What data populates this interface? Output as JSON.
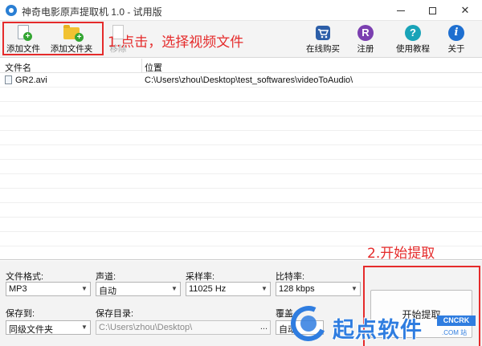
{
  "window": {
    "title": "神奇电影原声提取机 1.0 - 试用版",
    "min_icon": "minimize-icon",
    "max_icon": "maximize-icon",
    "close_glyph": "✕"
  },
  "toolbar": {
    "add_file": "添加文件",
    "add_folder": "添加文件夹",
    "remove": "移除",
    "buy": "在线购买",
    "register": "注册",
    "register_glyph": "R",
    "help": "使用教程",
    "help_glyph": "?",
    "about": "关于",
    "about_glyph": "i",
    "plus_glyph": "+"
  },
  "annotations": {
    "step1": "1.点击，选择视频文件",
    "step2": "2.开始提取"
  },
  "file_list": {
    "col_name": "文件名",
    "col_location": "位置",
    "rows": [
      {
        "name": "GR2.avi",
        "location": "C:\\Users\\zhou\\Desktop\\test_softwares\\videoToAudio\\"
      }
    ]
  },
  "settings": {
    "format_label": "文件格式:",
    "format_value": "MP3",
    "channel_label": "声道:",
    "channel_value": "自动",
    "samplerate_label": "采样率:",
    "samplerate_value": "11025 Hz",
    "bitrate_label": "比特率:",
    "bitrate_value": "128 kbps",
    "saveto_label": "保存到:",
    "saveto_value": "同级文件夹",
    "savedir_label": "保存目录:",
    "savedir_value": "C:\\Users\\zhou\\Desktop\\",
    "browse_label": "...",
    "overwrite_label": "覆盖",
    "overwrite_value": "自动",
    "dropdown_glyph": "▼"
  },
  "start_button": {
    "label": "开始提取"
  },
  "watermark": {
    "text": "起点软件",
    "tag": "CNCRK",
    "sub": ".COM 站"
  },
  "colors": {
    "annotation": "#e52b2b",
    "watermark": "#2f7de0"
  }
}
